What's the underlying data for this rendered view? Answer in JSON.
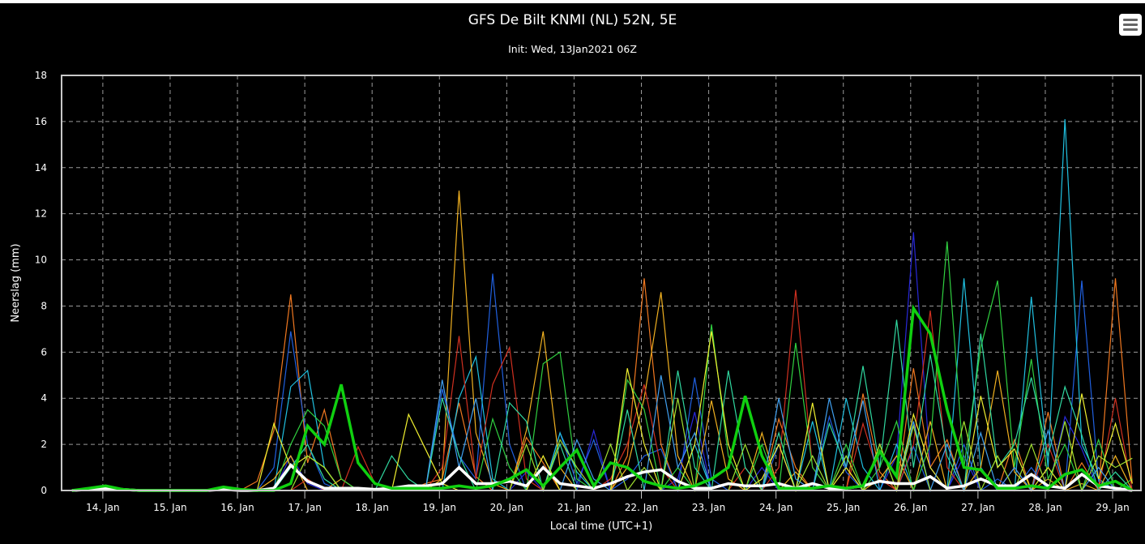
{
  "header": {
    "title": "GFS De Bilt KNMI (NL) 52N, 5E",
    "subtitle": "Init: Wed, 13Jan2021 06Z",
    "menu_icon": "hamburger-menu-icon"
  },
  "chart_data": {
    "type": "line",
    "title": "GFS De Bilt KNMI (NL) 52N, 5E",
    "subtitle": "Init: Wed, 13Jan2021 06Z",
    "xlabel": "Local time (UTC+1)",
    "ylabel": "Neerslag (mm)",
    "ylim": [
      0,
      18
    ],
    "yticks": [
      0,
      2,
      4,
      6,
      8,
      10,
      12,
      14,
      16,
      18
    ],
    "xlim_hours_since_13jan_0000": [
      9.3,
      394.1
    ],
    "xticks": [
      {
        "label": "14. Jan",
        "hour": 24
      },
      {
        "label": "15. Jan",
        "hour": 48
      },
      {
        "label": "16. Jan",
        "hour": 72
      },
      {
        "label": "17. Jan",
        "hour": 96
      },
      {
        "label": "18. Jan",
        "hour": 120
      },
      {
        "label": "19. Jan",
        "hour": 144
      },
      {
        "label": "20. Jan",
        "hour": 168
      },
      {
        "label": "21. Jan",
        "hour": 192
      },
      {
        "label": "22. Jan",
        "hour": 216
      },
      {
        "label": "23. Jan",
        "hour": 240
      },
      {
        "label": "24. Jan",
        "hour": 264
      },
      {
        "label": "25. Jan",
        "hour": 288
      },
      {
        "label": "26. Jan",
        "hour": 312
      },
      {
        "label": "27. Jan",
        "hour": 336
      },
      {
        "label": "28. Jan",
        "hour": 360
      },
      {
        "label": "29. Jan",
        "hour": 384
      }
    ],
    "x_start_hour": 13,
    "x_step_hours": 6,
    "grid": true,
    "legend": "none",
    "series": [
      {
        "name": "member-orange",
        "color": "#f07820",
        "width": 1.2,
        "values": [
          0,
          0,
          0,
          0,
          0,
          0,
          0,
          0,
          0,
          0,
          0,
          0.4,
          2.6,
          8.5,
          1.2,
          3.5,
          0.5,
          0,
          0,
          0,
          0,
          0.3,
          0.5,
          3.8,
          0.6,
          0,
          0,
          2.3,
          1.2,
          0,
          0,
          0,
          0,
          1.5,
          9.2,
          2.0,
          0,
          0,
          0,
          0,
          0,
          0,
          3.1,
          1.0,
          0,
          0,
          0,
          4.2,
          0.8,
          0,
          5.3,
          1.0,
          2.2,
          0,
          0,
          0,
          2.2,
          0,
          3.4,
          0,
          1.2,
          0,
          9.2,
          0.3
        ]
      },
      {
        "name": "member-blue",
        "color": "#2060e0",
        "width": 1.2,
        "values": [
          0,
          0,
          0,
          0,
          0,
          0,
          0,
          0,
          0,
          0,
          0,
          0,
          1.0,
          6.9,
          2.0,
          0.3,
          0,
          0,
          0,
          0,
          0,
          0,
          4.4,
          1.5,
          0.5,
          9.4,
          2.0,
          0,
          0,
          2.5,
          0.3,
          2.2,
          0,
          0.5,
          1.5,
          1.8,
          0,
          4.9,
          0.5,
          0,
          0,
          0,
          2.0,
          0,
          0,
          3.2,
          0.8,
          0,
          0,
          0,
          1.9,
          0,
          0,
          2.0,
          0,
          0.5,
          0,
          1.0,
          0,
          0,
          9.1,
          0.4,
          0,
          0
        ]
      },
      {
        "name": "member-darkblue",
        "color": "#2828d8",
        "width": 1.2,
        "values": [
          0,
          0,
          0,
          0,
          0,
          0,
          0,
          0,
          0,
          0,
          0,
          0,
          0,
          1.5,
          0.3,
          0,
          0,
          0,
          0,
          0,
          0,
          0,
          0,
          0,
          0,
          0,
          0,
          0.8,
          0,
          0,
          0,
          2.6,
          0,
          0,
          0,
          0,
          0.5,
          3.4,
          0,
          0,
          0,
          1.0,
          0,
          0,
          0,
          0,
          0,
          0,
          0,
          1.5,
          11.2,
          1.0,
          0,
          1.5,
          0,
          0,
          0,
          0,
          0,
          3.2,
          1.8,
          0,
          0,
          0.2
        ]
      },
      {
        "name": "member-cyan",
        "color": "#20c0e0",
        "width": 1.2,
        "values": [
          0,
          0,
          0,
          0,
          0,
          0,
          0,
          0,
          0,
          0,
          0,
          0,
          0,
          4.5,
          5.2,
          1.0,
          0,
          0,
          0,
          0,
          0,
          0,
          0,
          4.0,
          5.8,
          0.5,
          0,
          0,
          0,
          2.5,
          0.8,
          0,
          0,
          0,
          0,
          0,
          0,
          2.0,
          0,
          0,
          0,
          0,
          0,
          0,
          3.0,
          0,
          4.0,
          1.0,
          0,
          2.0,
          0,
          0,
          0,
          9.2,
          1.0,
          0,
          0,
          8.4,
          1.0,
          16.1,
          2.0,
          0.5,
          0,
          0
        ]
      },
      {
        "name": "member-gold",
        "color": "#f0b020",
        "width": 1.2,
        "values": [
          0,
          0,
          0,
          0,
          0,
          0,
          0,
          0,
          0,
          0,
          0,
          0,
          0.5,
          1.5,
          0,
          0,
          0.5,
          0,
          0,
          0,
          0,
          0,
          0.5,
          13.0,
          2.5,
          0.3,
          0,
          2.6,
          6.9,
          1.0,
          0,
          0,
          0,
          1.0,
          4.0,
          8.6,
          1.5,
          0,
          3.9,
          0.5,
          0,
          2.5,
          0,
          0.8,
          0,
          0,
          0,
          0,
          0.5,
          1.5,
          0,
          3.0,
          0,
          0,
          1.0,
          5.2,
          0.8,
          0,
          0.5,
          0,
          0.3,
          0,
          1.5,
          0
        ]
      },
      {
        "name": "member-red",
        "color": "#d03020",
        "width": 1.2,
        "values": [
          0,
          0,
          0,
          0,
          0,
          0,
          0,
          0,
          0,
          0,
          0,
          0,
          0,
          0,
          0.5,
          0,
          0,
          1.9,
          0.3,
          0,
          0,
          0,
          1.0,
          6.7,
          0.5,
          4.6,
          6.2,
          0.5,
          0,
          0,
          0,
          0,
          0.5,
          2.0,
          4.6,
          1.0,
          0,
          0,
          0,
          0,
          1.0,
          0,
          1.0,
          8.7,
          1.0,
          0,
          0,
          2.9,
          0.5,
          0,
          2.0,
          7.8,
          1.0,
          0,
          0,
          0,
          1.0,
          0,
          2.0,
          0,
          0,
          0,
          4.0,
          0
        ]
      },
      {
        "name": "member-green",
        "color": "#30d040",
        "width": 1.2,
        "values": [
          0,
          0,
          0,
          0,
          0,
          0,
          0,
          0,
          0,
          0,
          0,
          0,
          0,
          2.0,
          3.5,
          2.8,
          0.5,
          0,
          0,
          0,
          0,
          0,
          0,
          0,
          0,
          3.1,
          1.0,
          0,
          5.5,
          6.0,
          0.5,
          0,
          0,
          4.8,
          3.5,
          0,
          1.0,
          0,
          7.2,
          1.5,
          0,
          2.0,
          0,
          6.4,
          1.0,
          0,
          2.0,
          0,
          1.0,
          3.0,
          0,
          2.0,
          10.8,
          1.0,
          6.2,
          9.1,
          1.0,
          5.7,
          0.5,
          2.0,
          0,
          2.2,
          0,
          0.5
        ]
      },
      {
        "name": "member-teal",
        "color": "#30d8a0",
        "width": 1.2,
        "values": [
          0,
          0,
          0,
          0,
          0,
          0,
          0,
          0,
          0,
          0,
          0,
          0,
          0,
          1.0,
          2.0,
          0.5,
          0,
          0,
          0,
          1.5,
          0.5,
          0,
          4.0,
          1.5,
          0,
          0,
          3.8,
          3.0,
          0,
          2.0,
          0,
          0,
          0,
          3.5,
          0,
          0,
          5.2,
          1.0,
          0,
          5.2,
          1.0,
          0,
          2.5,
          0,
          0,
          2.9,
          1.0,
          5.4,
          1.0,
          7.4,
          1.0,
          5.9,
          1.5,
          0,
          6.8,
          1.0,
          2.0,
          4.9,
          1.5,
          4.5,
          2.4,
          0,
          0.8,
          0
        ]
      },
      {
        "name": "member-yellow",
        "color": "#f0f030",
        "width": 1.2,
        "values": [
          0,
          0,
          0,
          0,
          0,
          0,
          0,
          0,
          0,
          0,
          0,
          0,
          2.9,
          1.0,
          1.5,
          1.0,
          0,
          0,
          0,
          0,
          3.3,
          1.8,
          0.3,
          0,
          0,
          0,
          0,
          0,
          1.5,
          0,
          0,
          0,
          0,
          5.3,
          2.0,
          0,
          0,
          2.0,
          6.9,
          2.0,
          0,
          0.5,
          2.0,
          0,
          3.8,
          0,
          1.0,
          0,
          2.0,
          0,
          3.3,
          1.0,
          0,
          0,
          4.1,
          1.0,
          1.8,
          0,
          1.0,
          0,
          4.2,
          0.5,
          2.9,
          0.3
        ]
      },
      {
        "name": "member-lightblue",
        "color": "#40a0f0",
        "width": 1.2,
        "values": [
          0,
          0,
          0,
          0,
          0,
          0,
          0,
          0,
          0,
          0,
          0,
          0,
          0,
          0,
          0,
          0,
          0,
          0,
          0,
          0,
          0,
          0,
          4.8,
          1.0,
          4.0,
          0,
          0,
          0,
          0,
          0,
          2.2,
          0.5,
          0,
          0,
          0,
          5.0,
          1.0,
          2.5,
          0,
          0,
          0,
          0,
          4.0,
          0.5,
          0,
          4.0,
          1.0,
          3.9,
          0,
          0,
          3.0,
          0,
          2.0,
          0,
          2.5,
          0,
          1.0,
          0,
          2.6,
          0,
          0,
          1.0,
          0,
          0
        ]
      },
      {
        "name": "member-lime",
        "color": "#a0e030",
        "width": 1.2,
        "values": [
          0,
          0,
          0,
          0,
          0,
          0,
          0,
          0,
          0,
          0,
          0,
          0,
          0,
          0,
          1.5,
          1.0,
          0,
          0,
          0,
          0,
          0,
          0,
          0,
          0,
          0,
          0,
          0,
          2.0,
          0,
          2.2,
          1.0,
          0,
          2.0,
          0,
          1.0,
          0,
          4.0,
          0,
          0,
          0,
          2.0,
          0,
          0,
          0,
          1.5,
          0,
          1.5,
          0,
          2.0,
          0,
          2.8,
          0,
          0,
          3.0,
          0,
          1.5,
          0,
          2.0,
          0,
          3.0,
          0,
          1.5,
          1.0,
          1.4
        ]
      },
      {
        "name": "ensemble-mean",
        "color": "#ffffff",
        "width": 3.5,
        "values": [
          0,
          0.05,
          0.1,
          0.05,
          0,
          0,
          0,
          0,
          0,
          0.05,
          0,
          0,
          0.1,
          1.1,
          0.4,
          0.1,
          0.1,
          0.1,
          0.05,
          0.1,
          0.2,
          0.2,
          0.3,
          1.0,
          0.3,
          0.3,
          0.4,
          0.2,
          1.0,
          0.3,
          0.2,
          0.1,
          0.3,
          0.6,
          0.8,
          0.9,
          0.4,
          0.1,
          0.1,
          0.3,
          0.2,
          0.2,
          0.3,
          0.1,
          0.3,
          0.1,
          0.1,
          0.2,
          0.4,
          0.3,
          0.3,
          0.6,
          0.1,
          0.2,
          0.5,
          0.2,
          0.2,
          0.7,
          0.2,
          0.1,
          0.7,
          0.2,
          0.1,
          0
        ]
      },
      {
        "name": "control-run",
        "color": "#10d010",
        "width": 3.5,
        "values": [
          0,
          0.1,
          0.2,
          0.05,
          0,
          0,
          0,
          0,
          0,
          0.15,
          0.05,
          0,
          0,
          0.3,
          2.8,
          2.0,
          4.6,
          1.2,
          0.3,
          0.1,
          0.1,
          0.1,
          0.1,
          0.2,
          0.1,
          0.2,
          0.5,
          0.9,
          0.2,
          1.0,
          1.75,
          0.2,
          1.2,
          1.0,
          0.4,
          0.2,
          0.1,
          0.2,
          0.5,
          1.0,
          4.1,
          1.5,
          0.1,
          0.1,
          0.1,
          0.2,
          0.1,
          0.2,
          1.7,
          0.6,
          7.9,
          6.8,
          3.5,
          1.0,
          0.9,
          0.1,
          0.1,
          0.2,
          0.1,
          0.7,
          0.9,
          0.2,
          0.4,
          0
        ]
      }
    ]
  }
}
